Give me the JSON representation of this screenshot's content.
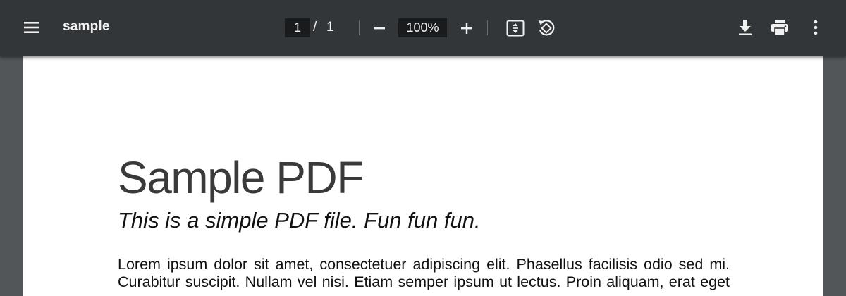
{
  "toolbar": {
    "menu_icon": "hamburger-menu-icon",
    "title": "sample",
    "page_current": "1",
    "page_separator": "/",
    "page_total": "1",
    "zoom_value": "100%",
    "icons": {
      "zoom_out": "minus-icon",
      "zoom_in": "plus-icon",
      "fit": "fit-to-page-icon",
      "rotate": "rotate-counterclockwise-icon",
      "download": "download-icon",
      "print": "print-icon",
      "more": "more-vertical-icon"
    },
    "colors": {
      "toolbar_bg": "#323639",
      "viewer_bg": "#525659",
      "input_bg": "#191b1c",
      "text": "#f1f1f1"
    }
  },
  "document": {
    "title": "Sample PDF",
    "subtitle": "This is a simple PDF file. Fun fun fun.",
    "body_line1": "Lorem ipsum dolor sit amet, consectetuer adipiscing elit. Phasellus facilisis odio sed mi.",
    "body_line2": "Curabitur suscipit. Nullam vel nisi. Etiam semper ipsum ut lectus. Proin aliquam, erat eget"
  }
}
